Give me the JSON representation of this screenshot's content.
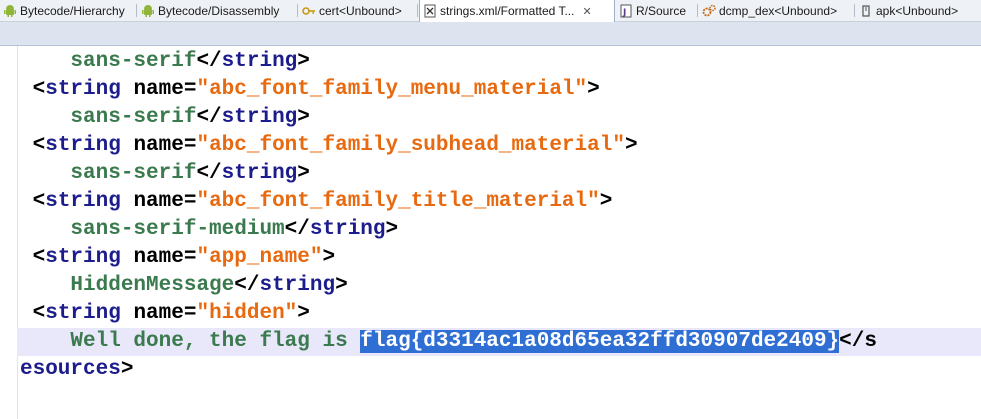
{
  "tabs": [
    {
      "label": "Bytecode/Hierarchy",
      "icon": "android-icon"
    },
    {
      "label": "Bytecode/Disassembly",
      "icon": "android-icon"
    },
    {
      "label": "cert<Unbound>",
      "icon": "key-icon"
    },
    {
      "label": "strings.xml/Formatted T...",
      "icon": "xml-file-icon",
      "active": true,
      "close": "✕"
    },
    {
      "label": "R/Source",
      "icon": "java-file-icon"
    },
    {
      "label": "dcmp_dex<Unbound>",
      "icon": "gears-icon"
    },
    {
      "label": "apk<Unbound>",
      "icon": "package-icon"
    }
  ],
  "code": {
    "l1_text": "sans-serif",
    "l1_close": "</",
    "l1_tag": "string",
    "l1_end": ">",
    "l2_open": "<",
    "l2_tag": "string",
    "l2_attr": " name=",
    "l2_val": "\"abc_font_family_menu_material\"",
    "l2_end": ">",
    "l3_text": "sans-serif",
    "l3_close": "</",
    "l3_tag": "string",
    "l3_end": ">",
    "l4_open": "<",
    "l4_tag": "string",
    "l4_attr": " name=",
    "l4_val": "\"abc_font_family_subhead_material\"",
    "l4_end": ">",
    "l5_text": "sans-serif",
    "l5_close": "</",
    "l5_tag": "string",
    "l5_end": ">",
    "l6_open": "<",
    "l6_tag": "string",
    "l6_attr": " name=",
    "l6_val": "\"abc_font_family_title_material\"",
    "l6_end": ">",
    "l7_text": "sans-serif-medium",
    "l7_close": "</",
    "l7_tag": "string",
    "l7_end": ">",
    "l8_open": "<",
    "l8_tag": "string",
    "l8_attr": " name=",
    "l8_val": "\"app_name\"",
    "l8_end": ">",
    "l9_text": "HiddenMessage",
    "l9_close": "</",
    "l9_tag": "string",
    "l9_end": ">",
    "l10_open": "<",
    "l10_tag": "string",
    "l10_attr": " name=",
    "l10_val": "\"hidden\"",
    "l10_end": ">",
    "l11_text": "Well done, the flag is ",
    "l11_selected": "flag{d3314ac1a08d65ea32ffd30907de2409}",
    "l11_close": "</s",
    "l12_tag": "esources",
    "l12_end": ">"
  }
}
